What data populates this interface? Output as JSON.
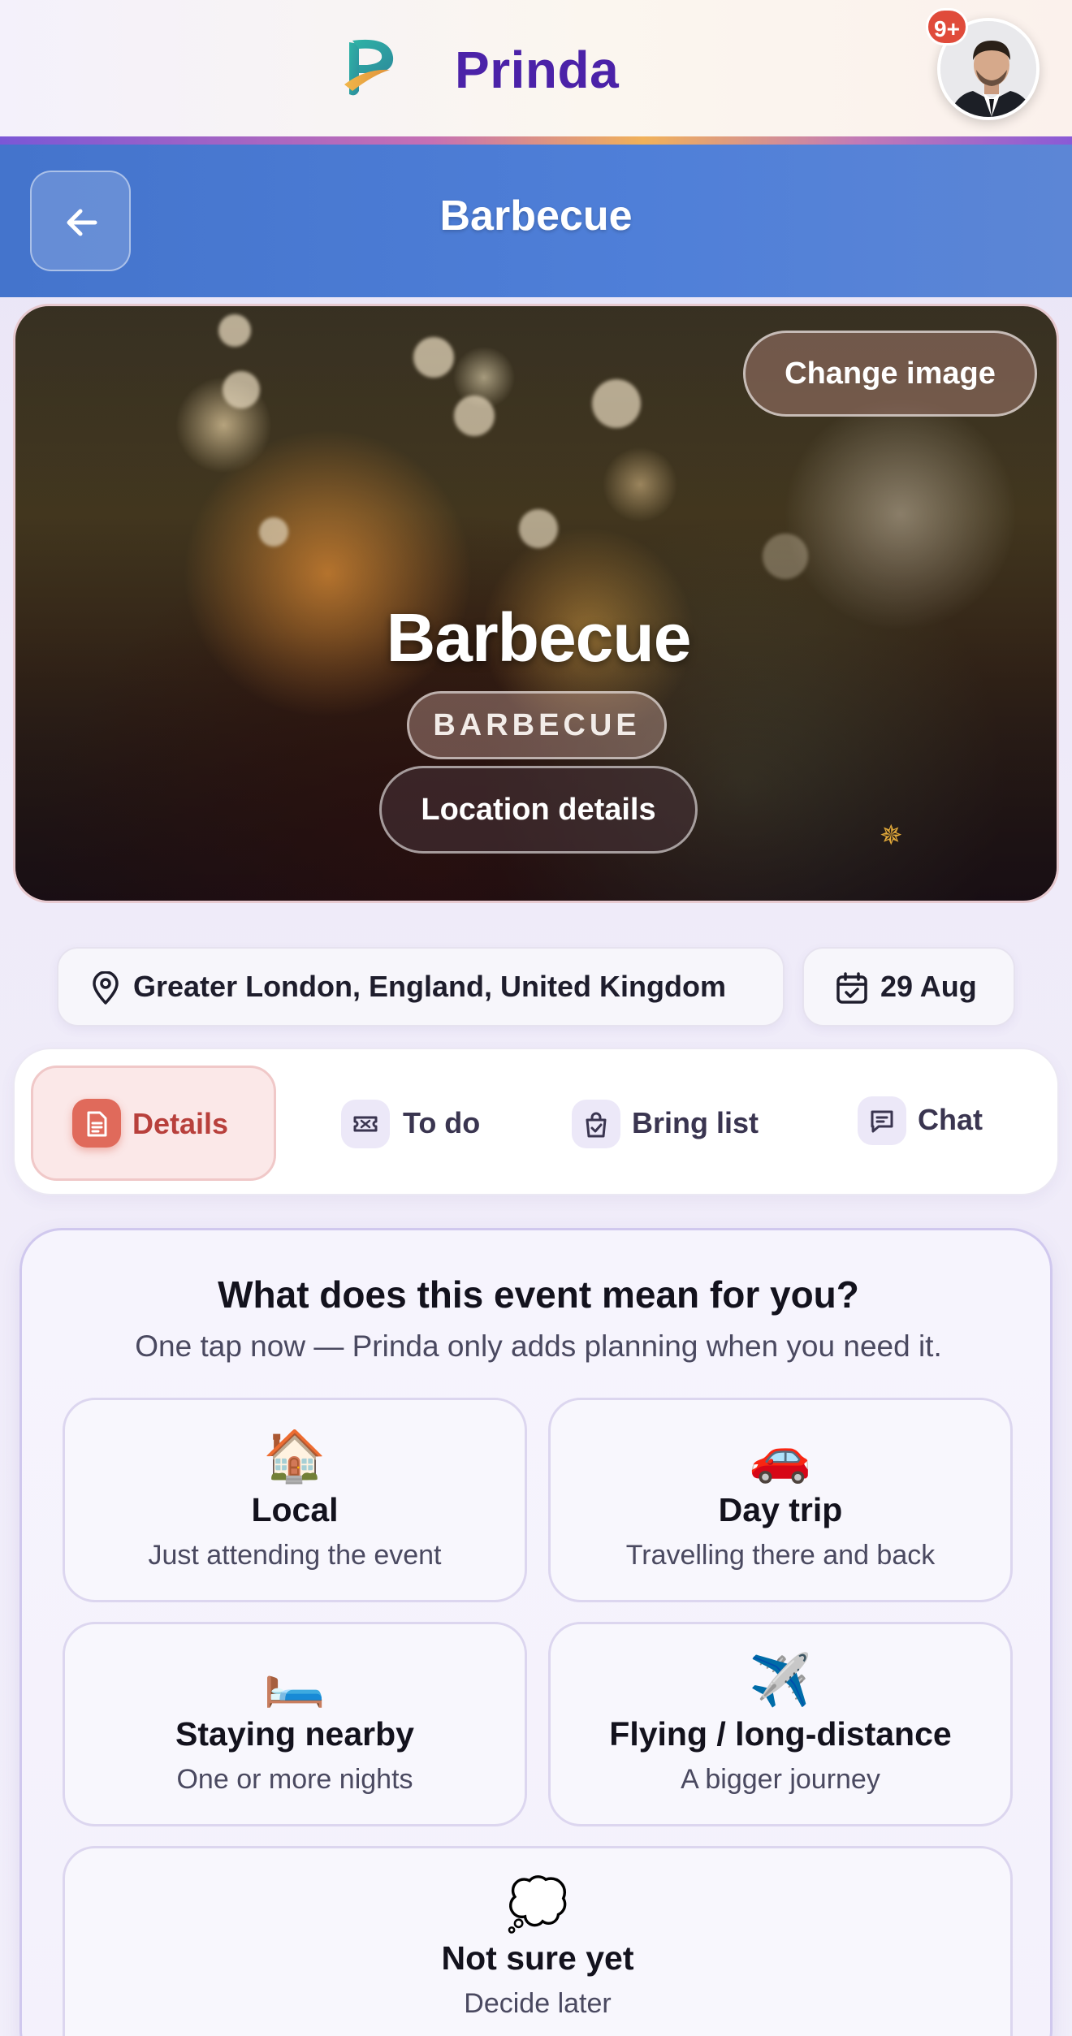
{
  "app": {
    "brand": "Prinda",
    "notification_badge": "9+"
  },
  "header": {
    "title": "Barbecue"
  },
  "hero": {
    "change_image_label": "Change image",
    "title": "Barbecue",
    "category_tag": "BARBECUE",
    "location_button": "Location details"
  },
  "info": {
    "location": "Greater London, England, United Kingdom",
    "date": "29 Aug"
  },
  "tabs": [
    {
      "label": "Details",
      "icon": "document-icon",
      "active": true
    },
    {
      "label": "To do",
      "icon": "ticket-icon",
      "active": false
    },
    {
      "label": "Bring list",
      "icon": "bag-check-icon",
      "active": false
    },
    {
      "label": "Chat",
      "icon": "chat-icon",
      "active": false
    }
  ],
  "question": {
    "title": "What does this event mean for you?",
    "subtitle": "One tap now — Prinda only adds planning when you need it.",
    "options": [
      {
        "emoji": "🏠",
        "title": "Local",
        "subtitle": "Just attending the event"
      },
      {
        "emoji": "🚗",
        "title": "Day trip",
        "subtitle": "Travelling there and back"
      },
      {
        "emoji": "🛏️",
        "title": "Staying nearby",
        "subtitle": "One or more nights"
      },
      {
        "emoji": "✈️",
        "title": "Flying / long-distance",
        "subtitle": "A bigger journey"
      },
      {
        "emoji": "💭",
        "title": "Not sure yet",
        "subtitle": "Decide later"
      }
    ]
  },
  "colors": {
    "brand_purple": "#4b22a8",
    "header_blue": "#4f7fd8",
    "active_tab_red": "#b8403c",
    "badge_red": "#e04b3b"
  }
}
